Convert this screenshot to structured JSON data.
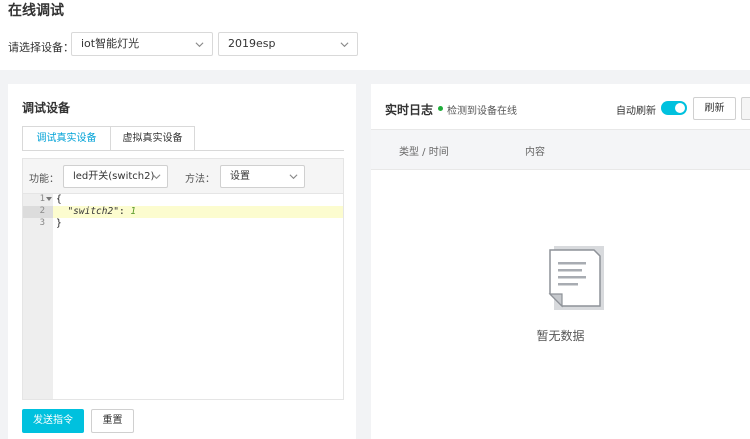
{
  "page": {
    "title": "在线调试"
  },
  "device_select": {
    "label": "请选择设备：",
    "product": "iot智能灯光",
    "device": "2019esp"
  },
  "debug_panel": {
    "title": "调试设备",
    "tabs": [
      {
        "label": "调试真实设备",
        "active": true
      },
      {
        "label": "虚拟真实设备",
        "active": false
      }
    ],
    "function_label": "功能：",
    "function_value": "led开关(switch2)",
    "method_label": "方法：",
    "method_value": "设置",
    "code": {
      "line_numbers": [
        "1",
        "2",
        "3"
      ],
      "open_brace": "{",
      "key": "\"switch2\"",
      "colon": ": ",
      "value": "1",
      "close_brace": "}"
    },
    "send_button": "发送指令",
    "reset_button": "重置"
  },
  "log_panel": {
    "title": "实时日志",
    "status": "检测到设备在线",
    "auto_refresh_label": "自动刷新",
    "auto_refresh_on": true,
    "refresh_button": "刷新",
    "columns": [
      "类型 / 时间",
      "内容"
    ],
    "empty_text": "暂无数据"
  },
  "colors": {
    "accent": "#00c1de",
    "tab_active": "#00a2d7",
    "online": "#1fad3a",
    "highlight_line": "#fcfccf"
  }
}
